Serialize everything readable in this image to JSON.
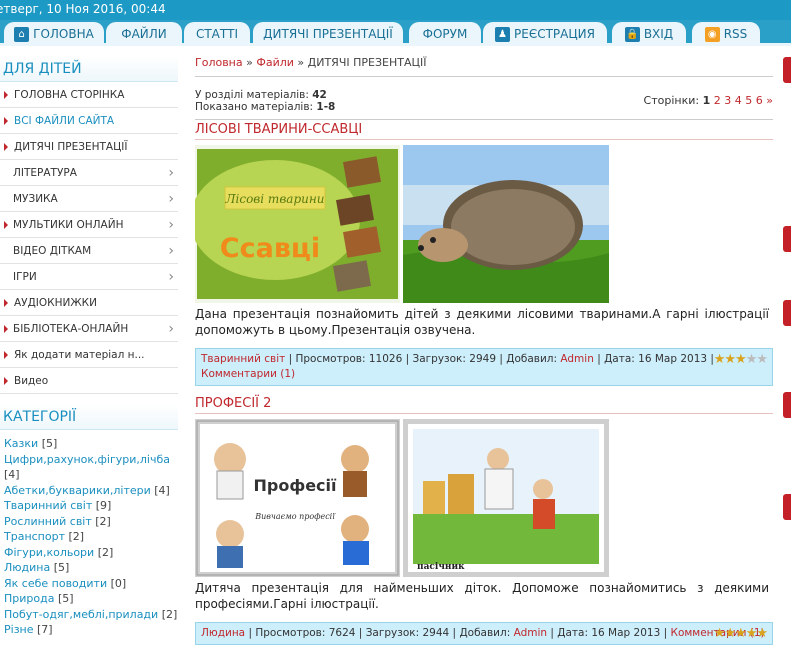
{
  "topbar": {
    "date": "етверг, 10 Ноя 2016, 00:44"
  },
  "nav": [
    {
      "label": "ГОЛОВНА",
      "icon": "home-icon",
      "glyph": "⌂"
    },
    {
      "label": "ФАЙЛИ"
    },
    {
      "label": "СТАТТІ"
    },
    {
      "label": "ДИТЯЧІ ПРЕЗЕНТАЦІЇ"
    },
    {
      "label": "ФОРУМ"
    },
    {
      "label": "РЕЄСТРАЦИЯ",
      "icon": "user-icon",
      "glyph": "♟"
    },
    {
      "label": "ВХІД",
      "icon": "lock-icon",
      "glyph": "🔒"
    },
    {
      "label": "RSS",
      "icon": "rss-icon",
      "glyph": "◉"
    }
  ],
  "sidebar": {
    "title": "ДЛЯ ДІТЕЙ",
    "items": [
      {
        "label": "ГОЛОВНА СТОРІНКА"
      },
      {
        "label": "ВСІ ФАЙЛИ САЙТА"
      },
      {
        "label": "ДИТЯЧІ ПРЕЗЕНТАЦІЇ"
      },
      {
        "label": "ЛІТЕРАТУРА"
      },
      {
        "label": "МУЗИКА"
      },
      {
        "label": "МУЛЬТИКИ ОНЛАЙН"
      },
      {
        "label": "ВІДЕО ДІТКАМ"
      },
      {
        "label": "ІГРИ"
      },
      {
        "label": "АУДІОКНИЖКИ"
      },
      {
        "label": "БІБЛІОТЕКА-ОНЛАЙН"
      },
      {
        "label": "Як додати матеріал н..."
      },
      {
        "label": "Видео"
      }
    ]
  },
  "categories": {
    "title": "КАТЕГОРІЇ",
    "items": [
      {
        "name": "Казки",
        "count": "[5]"
      },
      {
        "name": "Цифри,рахунок,фігури,лічба",
        "count": "[4]"
      },
      {
        "name": "Абетки,букварики,літери",
        "count": "[4]"
      },
      {
        "name": "Тваринний світ",
        "count": "[9]"
      },
      {
        "name": "Рослинний світ",
        "count": "[2]"
      },
      {
        "name": "Транспорт",
        "count": "[2]"
      },
      {
        "name": "Фігури,кольори",
        "count": "[2]"
      },
      {
        "name": "Людина",
        "count": "[5]"
      },
      {
        "name": "Як себе поводити",
        "count": "[0]"
      },
      {
        "name": "Природа",
        "count": "[5]"
      },
      {
        "name": "Побут-одяг,меблі,прилади",
        "count": "[2]"
      },
      {
        "name": "Різне",
        "count": "[7]"
      }
    ]
  },
  "breadcrumb": {
    "home": "Головна",
    "sep": "»",
    "files": "Файли",
    "current": "ДИТЯЧІ ПРЕЗЕНТАЦІЇ"
  },
  "info": {
    "total_label": "У розділі матеріалів:",
    "total": "42",
    "shown_label": "Показано матеріалів:",
    "shown": "1-8"
  },
  "pagination": {
    "label": "Сторінки:",
    "current": "1",
    "pages": [
      "2",
      "3",
      "4",
      "5",
      "6"
    ],
    "next": "»"
  },
  "entries": [
    {
      "title": "ЛІСОВІ ТВАРИНИ-ССАВЦІ",
      "image1_text": "Лісові тварини",
      "image1_big": "Ссавці",
      "description": "Дана презентація познайомить дітей з деякими лісовими тваринами.А гарні ілюстрації допоможуть в цьому.Презентація озвучена.",
      "category": "Тваринний світ",
      "views_label": "Просмотров:",
      "views": "11026",
      "downloads_label": "Загрузок:",
      "downloads": "2949",
      "author_label": "Добавил:",
      "author": "Admin",
      "date_label": "Дата:",
      "date": "16 Мар 2013",
      "comments": "Комментарии (1)",
      "rating": 3
    },
    {
      "title": "ПРОФЕСІЇ 2",
      "image1_text": "Професії",
      "image1_sub": "Вивчаємо професії",
      "image2_caption": "пасічник",
      "description": "Дитяча презентація для найменьших діток. Допоможе познайомитись з деякими професіями.Гарні ілюстрації.",
      "category": "Людина",
      "views_label": "Просмотров:",
      "views": "7624",
      "downloads_label": "Загрузок:",
      "downloads": "2944",
      "author_label": "Добавил:",
      "author": "Admin",
      "date_label": "Дата:",
      "date": "16 Мар 2013",
      "comments": "Комментарии (1)",
      "rating": 5
    }
  ],
  "colors": {
    "accent": "#1c99c4",
    "link_red": "#c0282d",
    "details_bg": "#cdeefb"
  }
}
